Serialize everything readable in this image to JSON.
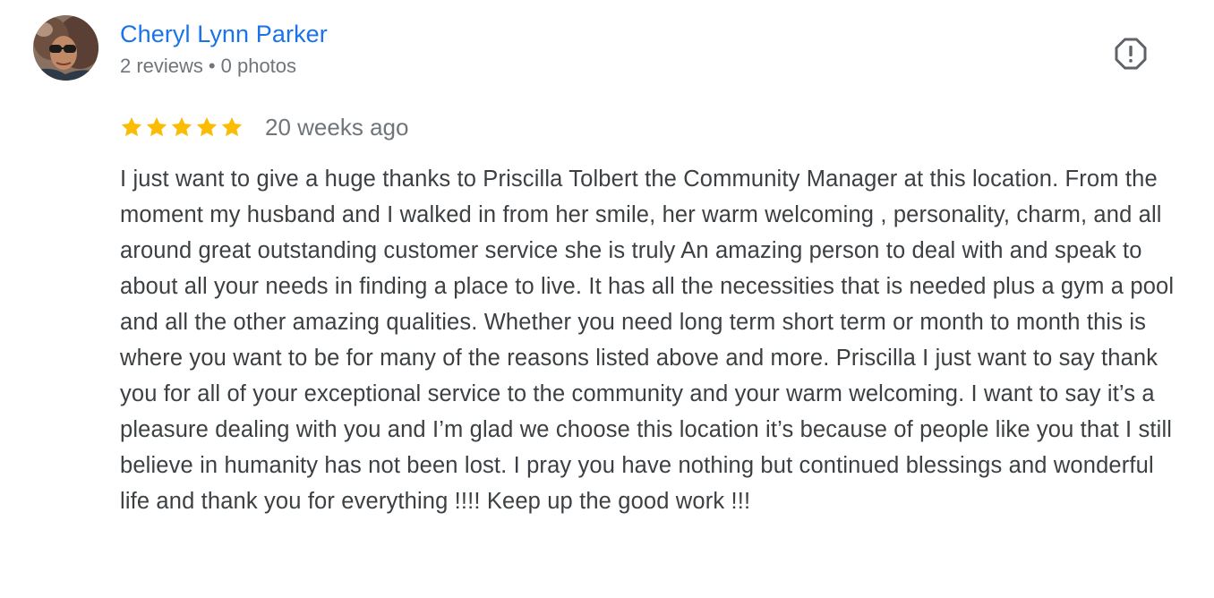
{
  "review": {
    "author": {
      "name": "Cheryl Lynn Parker",
      "reviews": "2 reviews",
      "separator": "•",
      "photos": "0 photos"
    },
    "report_icon": "report-flag-icon",
    "rating": 5,
    "rating_max": 5,
    "star_color": "#fbbc04",
    "date": "20 weeks ago",
    "text": "I just want to give a huge thanks to Priscilla Tolbert the Community Manager at this location. From the moment my husband and I walked in from her smile, her warm welcoming , personality, charm, and all around great outstanding customer service she is truly An amazing person to deal with and speak to about all your needs in finding a place to live. It has all the necessities that is needed plus a gym a pool and all the other amazing qualities. Whether you need long term short term or month to month this is where you want to be for many of the reasons listed above and more. Priscilla I just want to say thank you for all of your exceptional service to the community and your warm welcoming. I want to say it’s a pleasure dealing with you and I’m glad we choose this location it’s because of people like you that I still believe in humanity has not been lost. I pray you have nothing but continued blessings and wonderful life and thank you for everything !!!! Keep up the good work !!!"
  },
  "colors": {
    "link": "#1a73e8",
    "meta": "#70757a",
    "body_text": "#3c4043",
    "icon": "#5f6368"
  }
}
